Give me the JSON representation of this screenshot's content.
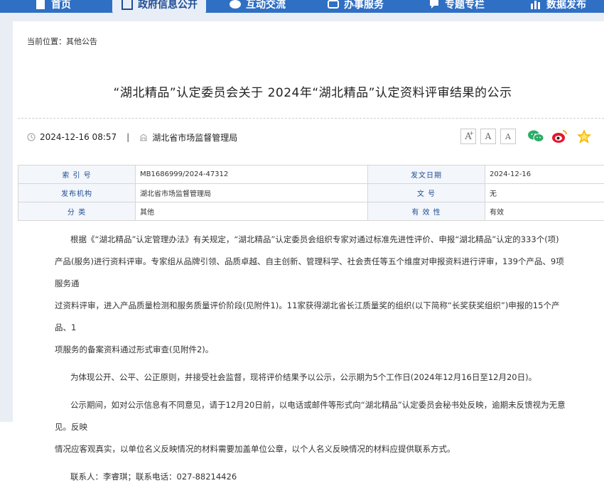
{
  "nav": {
    "items": [
      {
        "label": "首页"
      },
      {
        "label": "政府信息公开",
        "active": true
      },
      {
        "label": "互动交流"
      },
      {
        "label": "办事服务"
      },
      {
        "label": "专题专栏"
      },
      {
        "label": "数据发布"
      }
    ]
  },
  "breadcrumb": {
    "prefix": "当前位置：",
    "current": "其他公告"
  },
  "article": {
    "title": "“湖北精品”认定委员会关于 2024年“湖北精品”认定资料评审结果的公示",
    "datetime": "2024-12-16 08:57",
    "separator": "|",
    "source": "湖北省市场监督管理局"
  },
  "tools": {
    "font_large": "A",
    "font_medium": "A",
    "font_small": "A",
    "plus_sign": "+",
    "icons": [
      "wechat-icon",
      "weibo-icon",
      "qzone-icon"
    ]
  },
  "info": {
    "index_label": "索 引 号",
    "index_value": "MB1686999/2024-47312",
    "date_label": "发文日期",
    "date_value": "2024-12-16",
    "org_label": "发布机构",
    "org_value": "湖北省市场监督管理局",
    "docno_label": "文  号",
    "docno_value": "无",
    "category_label": "分  类",
    "category_value": "其他",
    "validity_label": "有 效 性",
    "validity_value": "有效"
  },
  "body": {
    "p1_l1": "根据《“湖北精品”认定管理办法》有关规定，“湖北精品”认定委员会组织专家对通过标准先进性评价、申报“湖北精品”认定的333个(项)",
    "p1_l2": "产品(服务)进行资料评审。专家组从品牌引领、品质卓越、自主创新、管理科学、社会责任等五个维度对申报资料进行评审，139个产品、9项服务通",
    "p1_l3": "过资料评审，进入产品质量检测和服务质量评价阶段(见附件1)。11家获得湖北省长江质量奖的组织(以下简称“长奖获奖组织”)申报的15个产品、1",
    "p1_l4": "项服务的备案资料通过形式审查(见附件2)。",
    "p2": "为体现公开、公平、公正原则，并接受社会监督，现将评价结果予以公示，公示期为5个工作日(2024年12月16日至12月20日)。",
    "p3_l1": "公示期间，如对公示信息有不同意见，请于12月20日前，以电话或邮件等形式向“湖北精品”认定委员会秘书处反映，逾期未反馈视为无意见。反映",
    "p3_l2": "情况应客观真实，以单位名义反映情况的材料需要加盖单位公章，以个人名义反映情况的材料应提供联系方式。",
    "contact": "联系人：李睿琪；联系电话：027-88214426"
  },
  "colors": {
    "nav": "#2f6fc4",
    "label_blue": "#1f4d94",
    "wechat": "#2aae67",
    "weibo": "#e6162d",
    "qzone": "#f5b800"
  }
}
